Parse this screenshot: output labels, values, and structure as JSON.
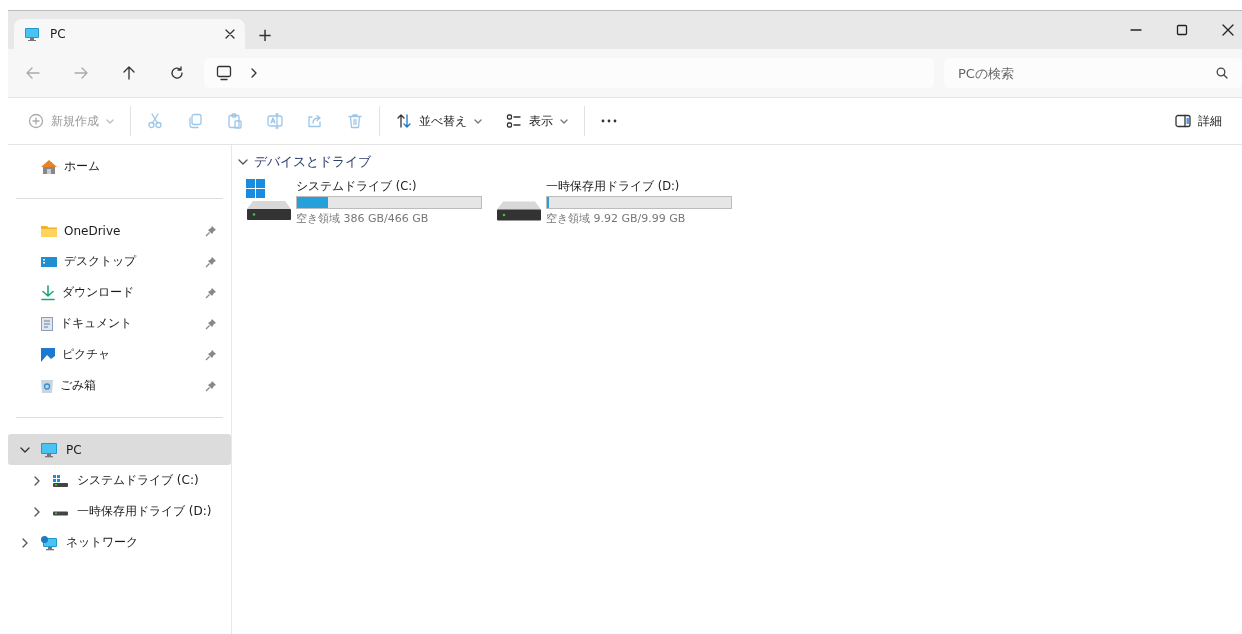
{
  "window": {
    "tabs": [
      {
        "title": "PC",
        "selected": true
      }
    ],
    "new_tab": "+"
  },
  "search": {
    "placeholder": "PCの検索"
  },
  "toolbar": [
    {
      "kind": "new",
      "label": "新規作成",
      "disabled": true,
      "dropdown": true
    },
    {
      "kind": "cut",
      "disabled": true
    },
    {
      "kind": "copy",
      "disabled": true
    },
    {
      "kind": "paste",
      "disabled": true
    },
    {
      "kind": "rename",
      "disabled": true
    },
    {
      "kind": "share",
      "disabled": true
    },
    {
      "kind": "delete",
      "disabled": true
    },
    {
      "kind": "sort",
      "label": "並べ替え",
      "disabled": false,
      "dropdown": true
    },
    {
      "kind": "view",
      "label": "表示",
      "disabled": false,
      "dropdown": true
    },
    {
      "kind": "more",
      "disabled": false
    }
  ],
  "details": {
    "label": "詳細"
  },
  "sidebar": {
    "home": {
      "label": "ホーム"
    },
    "pinned": [
      {
        "kind": "onedrive",
        "label": "OneDrive",
        "pinned": true
      },
      {
        "kind": "desktop",
        "label": "デスクトップ",
        "pinned": true
      },
      {
        "kind": "download",
        "label": "ダウンロード",
        "pinned": true
      },
      {
        "kind": "document",
        "label": "ドキュメント",
        "pinned": true
      },
      {
        "kind": "picture",
        "label": "ピクチャ",
        "pinned": true
      },
      {
        "kind": "trash",
        "label": "ごみ箱",
        "pinned": true
      }
    ],
    "tree": [
      {
        "kind": "pc",
        "label": "PC",
        "expanded": true,
        "selected": true,
        "children": [
          {
            "kind": "system",
            "label": "システムドライブ (C:)",
            "expanded": false,
            "selected": false
          },
          {
            "kind": "drive",
            "label": "一時保存用ドライブ (D:)",
            "expanded": false,
            "selected": false
          }
        ]
      },
      {
        "kind": "network",
        "label": "ネットワーク",
        "expanded": false,
        "selected": false
      }
    ]
  },
  "section": {
    "title": "デバイスとドライブ",
    "expanded": true,
    "drives": [
      {
        "kind": "system",
        "name": "システムドライブ (C:)",
        "level": 0.17,
        "free": "空き領域 386 GB/466 GB"
      },
      {
        "kind": "drive",
        "name": "一時保存用ドライブ (D:)",
        "level": 0.01,
        "free": "空き領域 9.92 GB/9.99 GB"
      }
    ]
  }
}
